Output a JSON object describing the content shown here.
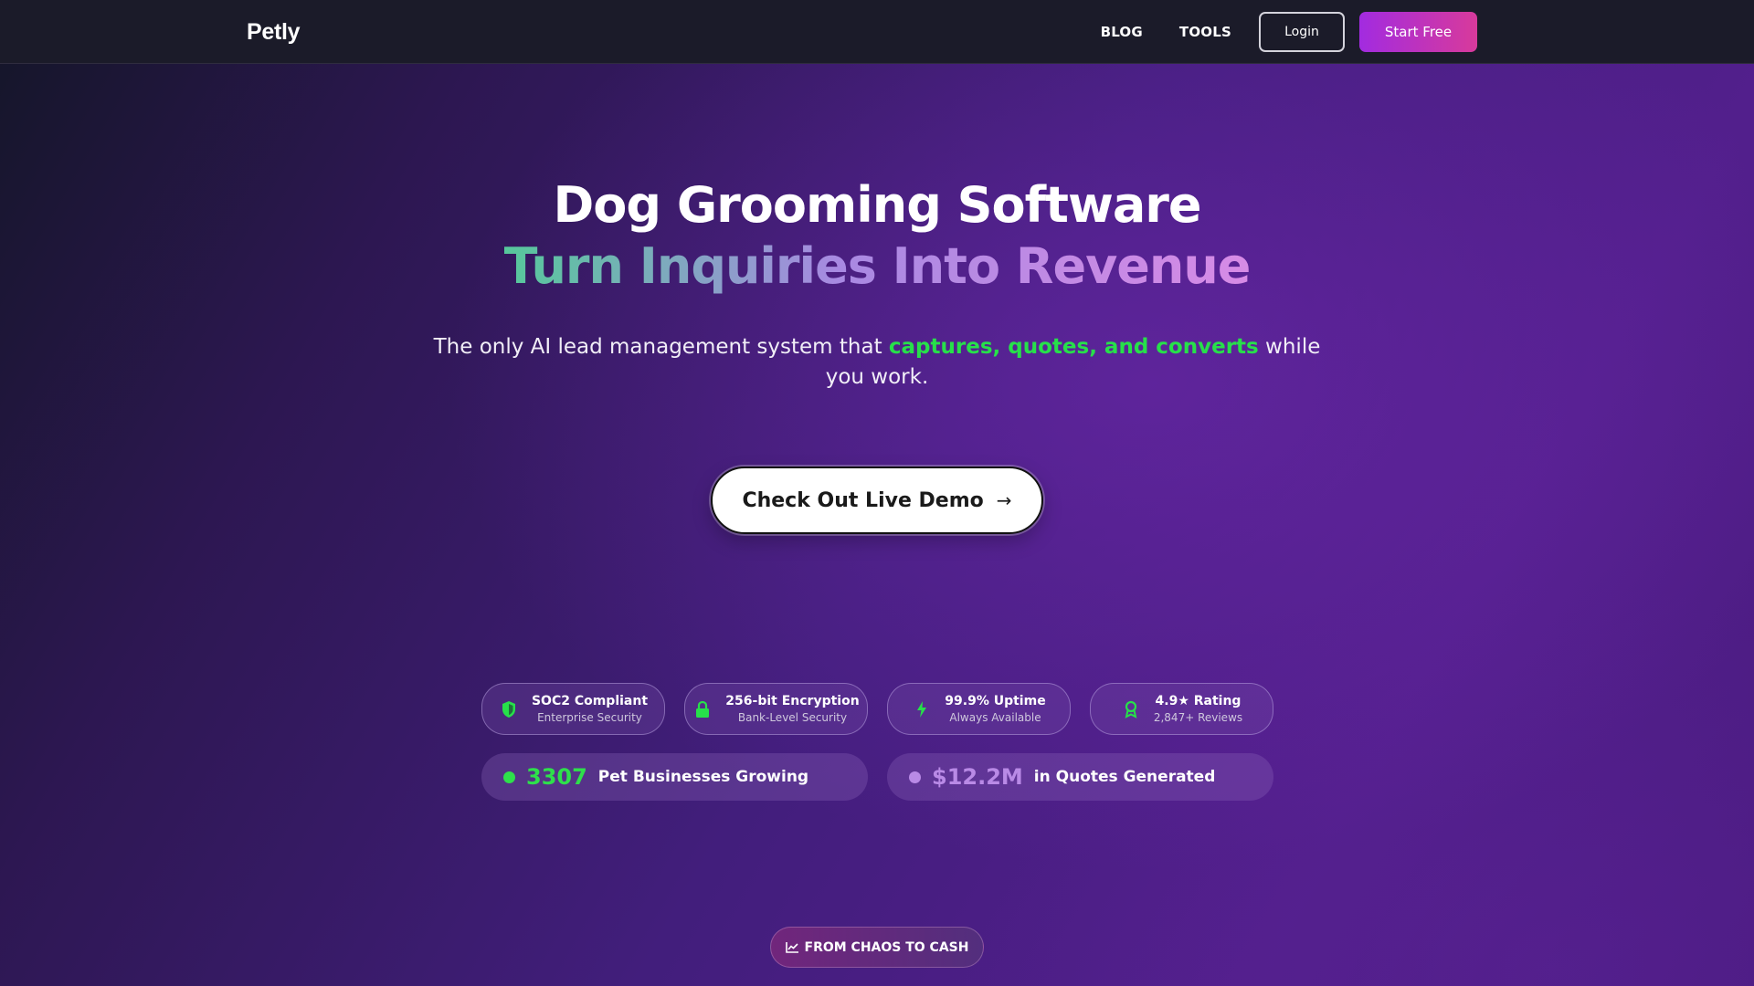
{
  "navbar": {
    "logo": "Petly",
    "links": [
      "BLOG",
      "TOOLS"
    ],
    "login_label": "Login",
    "start_label": "Start Free"
  },
  "hero": {
    "title_line1": "Dog Grooming Software",
    "title_line2": "Turn Inquiries Into Revenue",
    "subtitle_before": "The only AI lead management system that ",
    "subtitle_highlight": "captures, quotes, and converts",
    "subtitle_after": " while you work.",
    "cta_label": "Check Out Live Demo",
    "cta_arrow": "→"
  },
  "badges": [
    {
      "icon": "shield-icon",
      "title": "SOC2 Compliant",
      "subtitle": "Enterprise Security"
    },
    {
      "icon": "lock-icon",
      "title": "256-bit Encryption",
      "subtitle": "Bank-Level Security"
    },
    {
      "icon": "lightning-icon",
      "title": "99.9% Uptime",
      "subtitle": "Always Available"
    },
    {
      "icon": "award-icon",
      "title": "4.9★ Rating",
      "subtitle": "2,847+ Reviews"
    }
  ],
  "stats": [
    {
      "number": "3307",
      "label": "Pet Businesses Growing",
      "color": "#2ee04b"
    },
    {
      "number": "$12.2M",
      "label": "in Quotes Generated",
      "color": "#b98ae6"
    }
  ],
  "section_pill": {
    "icon": "chart-line-icon",
    "label": "FROM CHAOS TO CASH"
  },
  "colors": {
    "accent_green": "#27e04a",
    "accent_purple": "#b98ae6",
    "start_gradient_from": "#a22be0",
    "start_gradient_to": "#d83a9b"
  }
}
